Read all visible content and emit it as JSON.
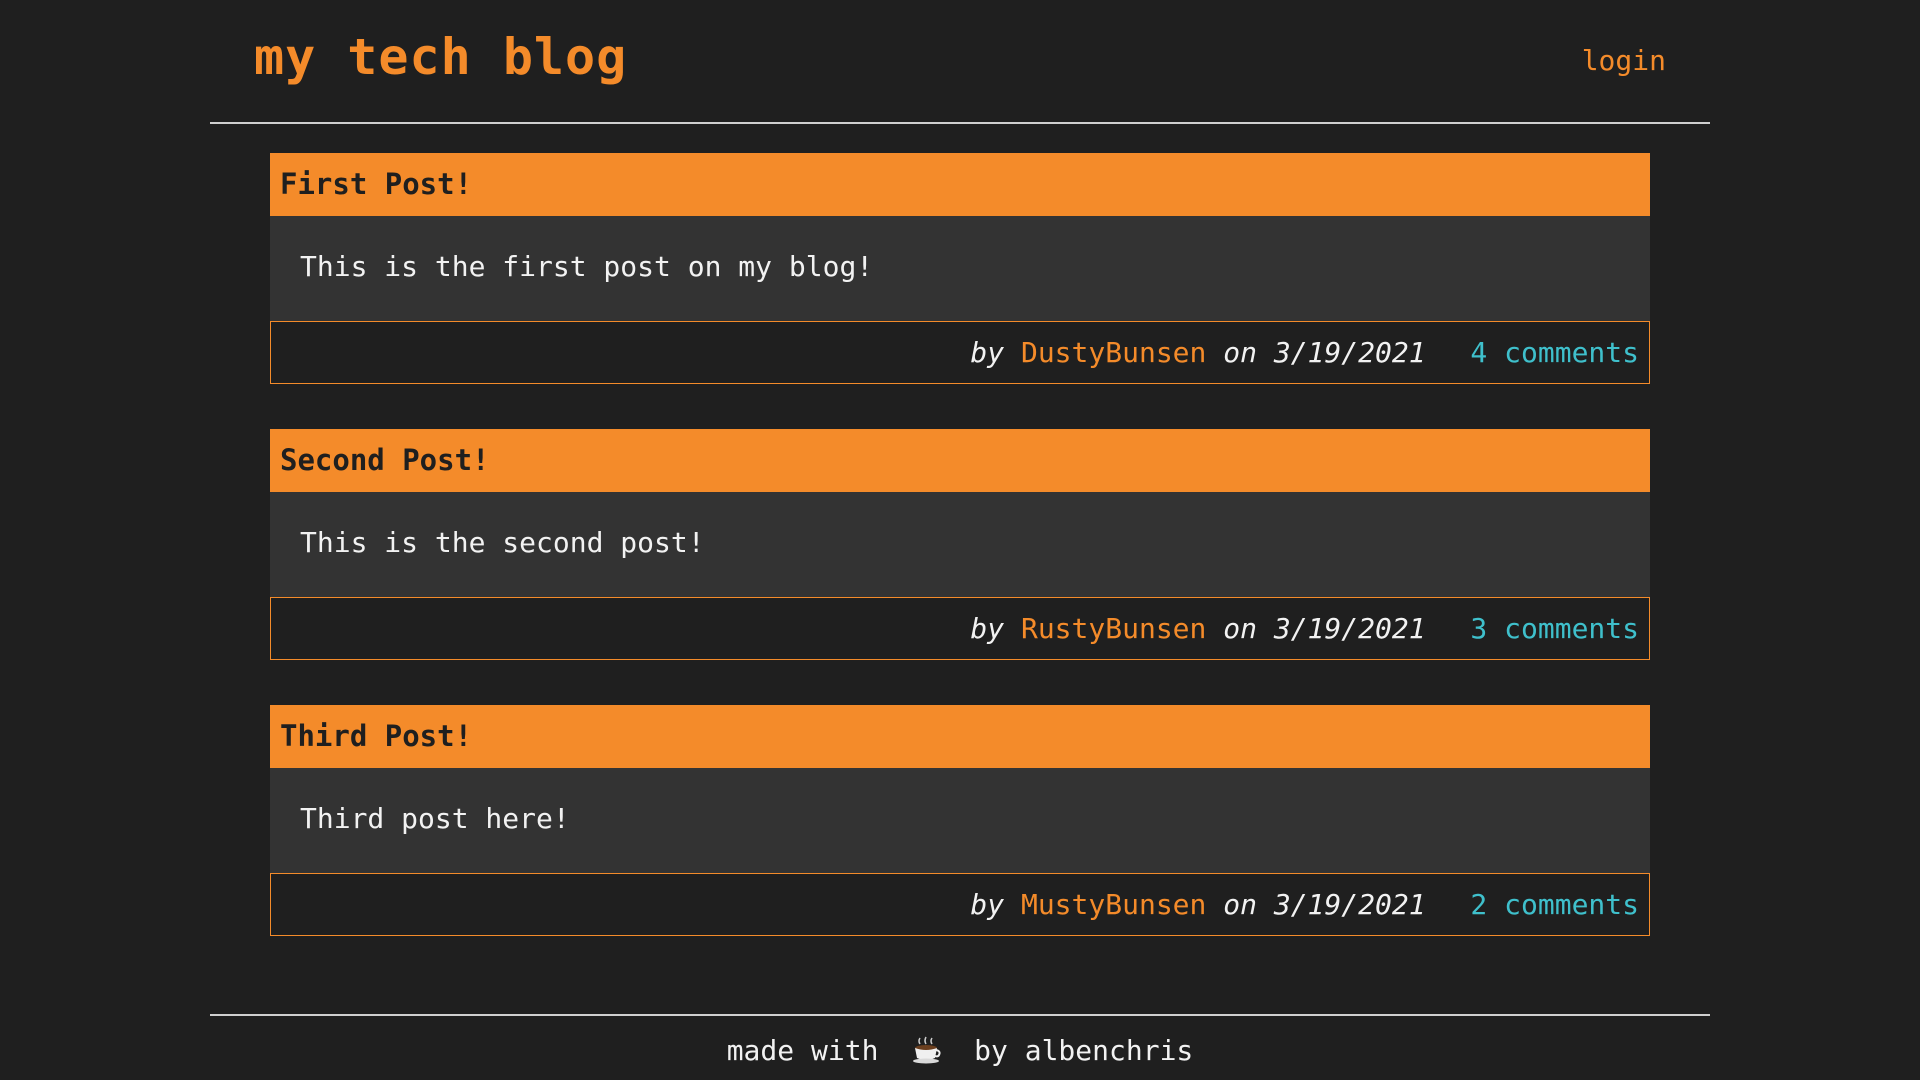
{
  "header": {
    "site_title": "my tech blog",
    "login_label": "login"
  },
  "posts": [
    {
      "title": "First Post!",
      "content": "This is the first post on my blog!",
      "by_label": "by",
      "author": "DustyBunsen",
      "on_label": "on",
      "date": "3/19/2021",
      "comments": "4 comments"
    },
    {
      "title": "Second Post!",
      "content": "This is the second post!",
      "by_label": "by",
      "author": "RustyBunsen",
      "on_label": "on",
      "date": "3/19/2021",
      "comments": "3 comments"
    },
    {
      "title": "Third Post!",
      "content": "Third post here!",
      "by_label": "by",
      "author": "MustyBunsen",
      "on_label": "on",
      "date": "3/19/2021",
      "comments": "2 comments"
    }
  ],
  "footer": {
    "made_with": "made with",
    "icon": "coffee-icon",
    "by_label": "by",
    "author": "albenchris"
  },
  "colors": {
    "background": "#1f1f1f",
    "accent": "#f48b2a",
    "post_body": "#333333",
    "link": "#3fc0cc",
    "text": "#f2f2f2"
  }
}
